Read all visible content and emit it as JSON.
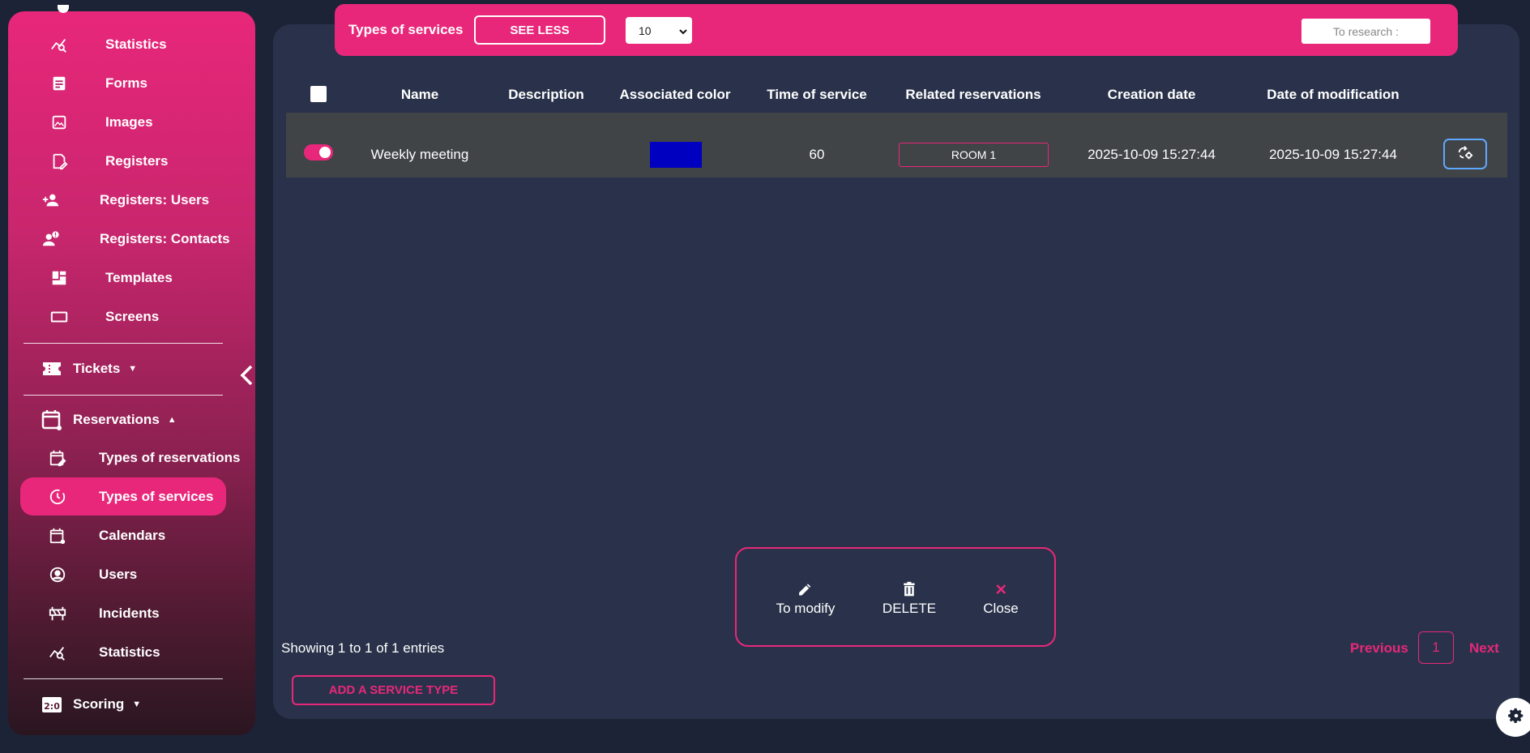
{
  "sidebar": {
    "items": [
      {
        "label": "Statistics",
        "icon": "statistics-icon"
      },
      {
        "label": "Forms",
        "icon": "forms-icon"
      },
      {
        "label": "Images",
        "icon": "images-icon"
      },
      {
        "label": "Registers",
        "icon": "registers-icon"
      },
      {
        "label": "Registers: Users",
        "icon": "add-user-icon"
      },
      {
        "label": "Registers: Contacts",
        "icon": "contacts-icon"
      },
      {
        "label": "Templates",
        "icon": "templates-icon"
      },
      {
        "label": "Screens",
        "icon": "screens-icon"
      }
    ],
    "tickets": {
      "label": "Tickets",
      "icon": "ticket-icon"
    },
    "reservations": {
      "label": "Reservations",
      "icon": "calendar-icon",
      "items": [
        {
          "label": "Types of reservations",
          "icon": "calendar-edit-icon"
        },
        {
          "label": "Types of services",
          "icon": "clock-icon",
          "active": true
        },
        {
          "label": "Calendars",
          "icon": "calendar-icon"
        },
        {
          "label": "Users",
          "icon": "user-circle-icon"
        },
        {
          "label": "Incidents",
          "icon": "barrier-icon"
        },
        {
          "label": "Statistics",
          "icon": "statistics-icon"
        }
      ]
    },
    "scoring": {
      "label": "Scoring",
      "icon": "scoreboard-icon"
    }
  },
  "topbar": {
    "title": "Types of services",
    "see_less": "SEE LESS",
    "page_size": "10",
    "search_placeholder": "To research :"
  },
  "table": {
    "columns": [
      "Name",
      "Description",
      "Associated color",
      "Time of service",
      "Related reservations",
      "Creation date",
      "Date of modification"
    ],
    "rows": [
      {
        "name": "Weekly meeting",
        "description": "",
        "color": "#0000c0",
        "time": "60",
        "reservation": "ROOM 1",
        "created": "2025-10-09 15:27:44",
        "modified": "2025-10-09 15:27:44",
        "enabled": true
      }
    ]
  },
  "popup": {
    "modify": "To modify",
    "delete": "DELETE",
    "close": "Close"
  },
  "footer": {
    "showing": "Showing 1 to 1 of 1 entries",
    "previous": "Previous",
    "current_page": "1",
    "next": "Next",
    "add_button": "ADD A SERVICE TYPE"
  },
  "colors": {
    "accent": "#e8277a",
    "panel": "#29324a",
    "background": "#1c2336"
  }
}
